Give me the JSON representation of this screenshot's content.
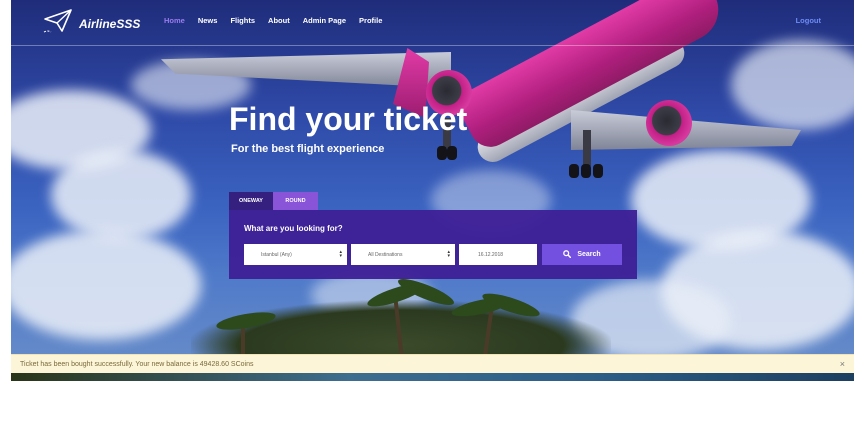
{
  "brand": {
    "name": "AirlineSSS",
    "logo_icon": "paper-plane-icon"
  },
  "nav": {
    "items": [
      {
        "label": "Home",
        "active": true
      },
      {
        "label": "News",
        "active": false
      },
      {
        "label": "Flights",
        "active": false
      },
      {
        "label": "About",
        "active": false
      },
      {
        "label": "Admin Page",
        "active": false
      },
      {
        "label": "Profile",
        "active": false
      }
    ],
    "logout_label": "Logout"
  },
  "hero": {
    "title": "Find your ticket",
    "subtitle": "For the best flight experience"
  },
  "search": {
    "tabs": [
      {
        "label": "ONEWAY",
        "active": true
      },
      {
        "label": "ROUND",
        "active": false
      }
    ],
    "heading": "What are you looking for?",
    "origin_value": "Istanbul (Any)",
    "destination_value": "All Destinations",
    "date_value": "16.12.2018",
    "search_label": "Search",
    "search_icon": "search-icon"
  },
  "alert": {
    "message": "Ticket has been bought successfully. Your new balance is 49428.60 SCoins",
    "close_label": "×"
  },
  "colors": {
    "accent": "#7450e0",
    "panel": "#3e1f96",
    "active_nav": "#9b7cf0",
    "logout": "#6d8cf6",
    "alert_bg": "#fcf5d8"
  }
}
